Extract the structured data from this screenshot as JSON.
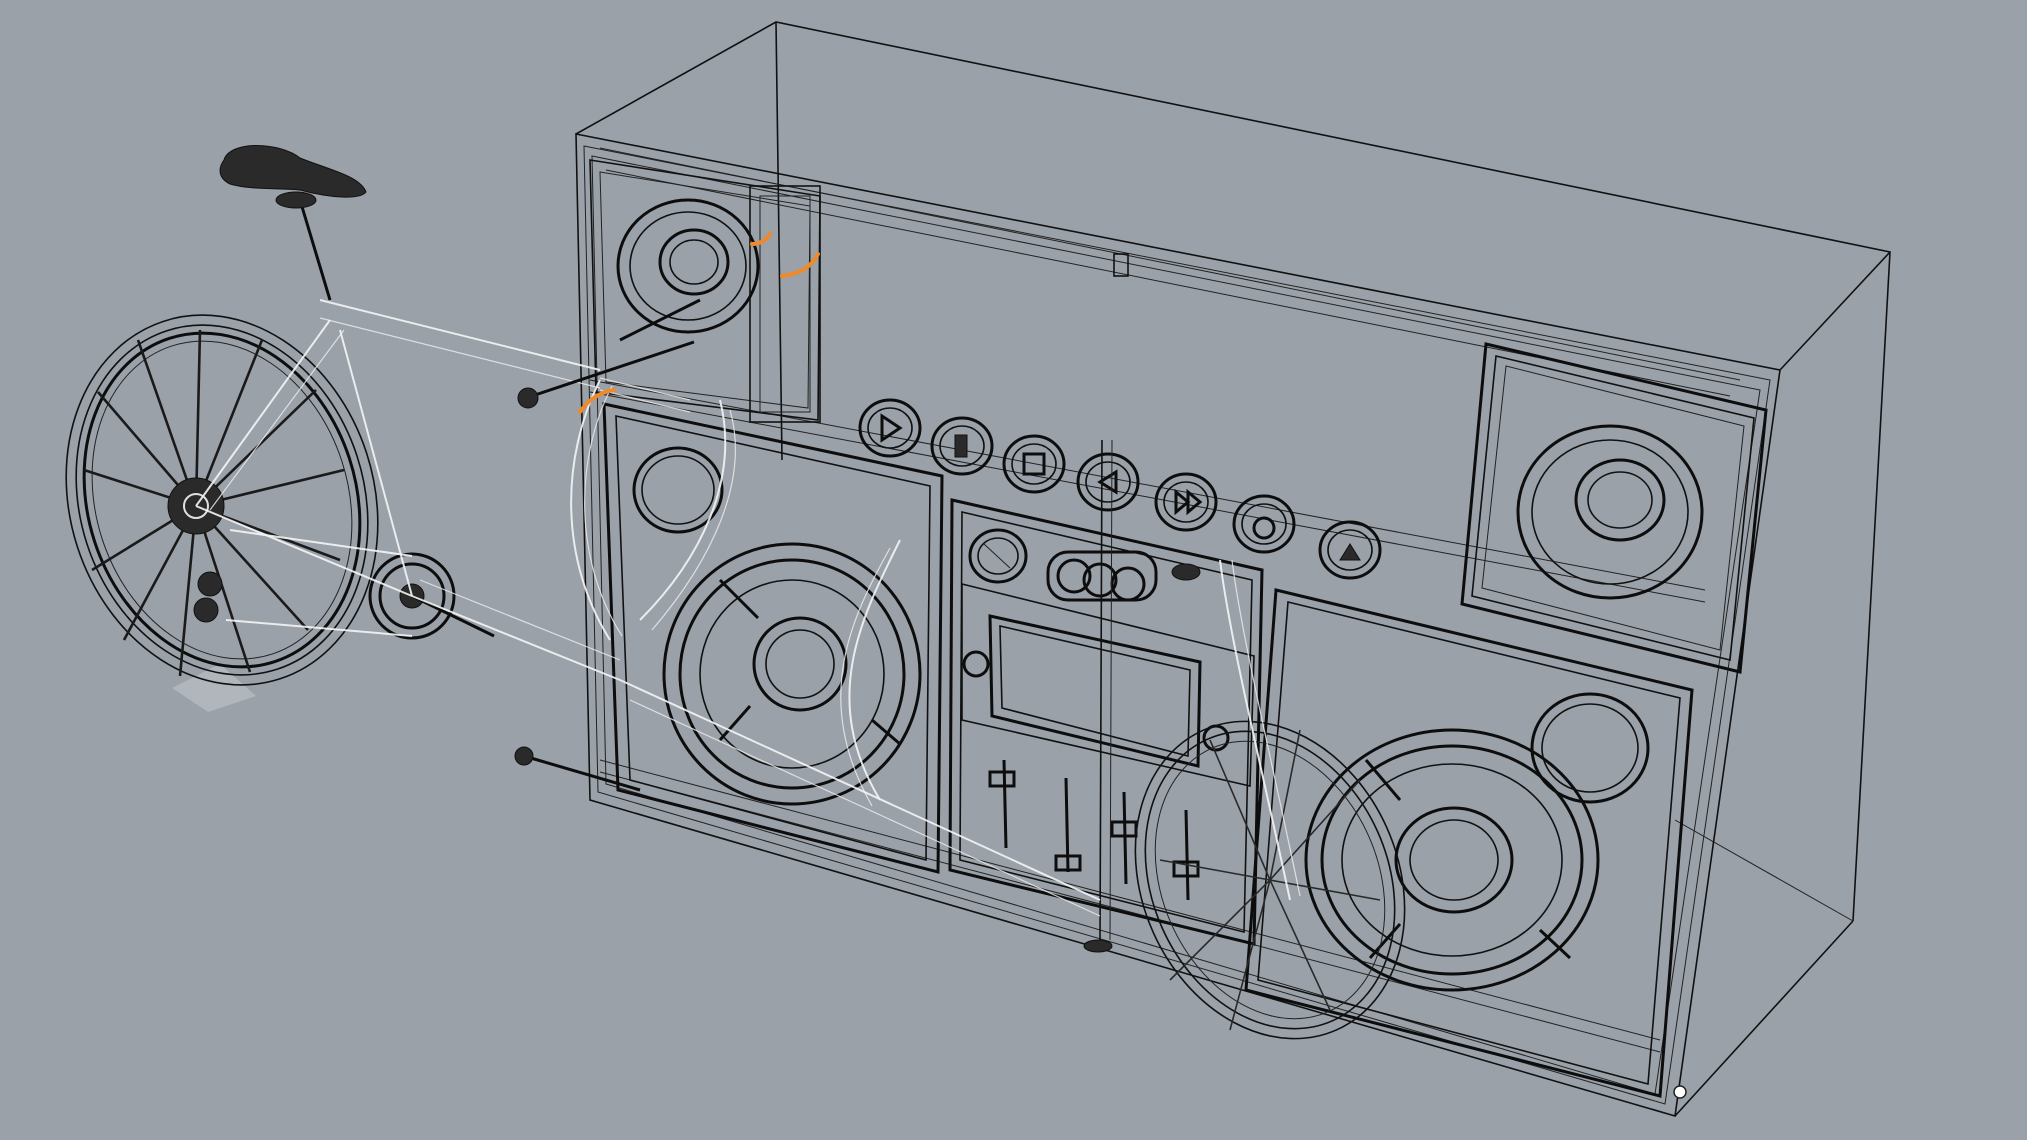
{
  "viewport": {
    "name": "perspective-viewport",
    "background_color": "#9aa1a9",
    "display_mode": "wireframe",
    "highlight_color": "#f0892a"
  },
  "scene": {
    "objects": [
      {
        "id": "boombox",
        "kind": "boombox-model"
      },
      {
        "id": "bicycle",
        "kind": "bicycle-model"
      },
      {
        "id": "bounding-box",
        "kind": "bounding-box"
      }
    ],
    "transport_buttons": [
      "play-icon",
      "pause-icon",
      "stop-icon",
      "rewind-icon",
      "fast-forward-icon",
      "record-icon",
      "eject-icon"
    ]
  }
}
